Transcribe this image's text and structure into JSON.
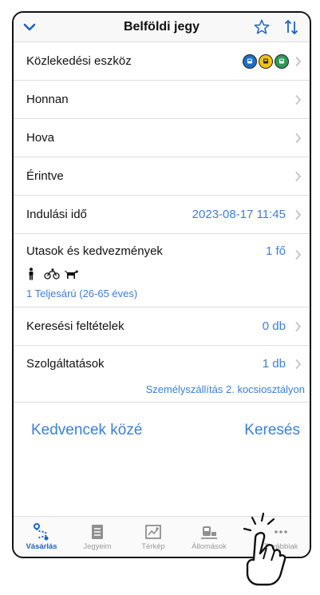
{
  "header": {
    "title": "Belföldi jegy",
    "icons": [
      "chevron-down-icon",
      "star-icon",
      "sort-icon"
    ]
  },
  "rows": {
    "transport": {
      "label": "Közlekedési eszköz",
      "icons": [
        "bus-icon",
        "tram-icon",
        "metro-icon"
      ]
    },
    "from": {
      "label": "Honnan"
    },
    "to": {
      "label": "Hova"
    },
    "via": {
      "label": "Érintve"
    },
    "departure": {
      "label": "Indulási idő",
      "value": "2023-08-17 11:45"
    },
    "passengers": {
      "label": "Utasok és kedvezmények",
      "value": "1 fő",
      "detail": "1 Teljesárú (26-65 éves)",
      "icons": [
        "person-icon",
        "bicycle-icon",
        "dog-icon"
      ]
    },
    "criteria": {
      "label": "Keresési feltételek",
      "value": "0 db"
    },
    "services": {
      "label": "Szolgáltatások",
      "value": "1 db",
      "detail": "Személyszállítás 2. kocsiosztályon"
    }
  },
  "actions": {
    "favorite": "Kedvencek közé",
    "search": "Keresés"
  },
  "tabbar": {
    "tabs": [
      {
        "label": "Vásárlás",
        "icon": "route-icon",
        "active": true
      },
      {
        "label": "Jegyeim",
        "icon": "ticket-icon",
        "active": false
      },
      {
        "label": "Térkép",
        "icon": "map-icon",
        "active": false
      },
      {
        "label": "Állomások",
        "icon": "station-icon",
        "active": false
      },
      {
        "label": "Továbbiak",
        "icon": "more-icon",
        "active": false
      }
    ]
  },
  "colors": {
    "accent": "#3b7fd8",
    "tab_active": "#1d63c4",
    "divider": "#dedede"
  }
}
